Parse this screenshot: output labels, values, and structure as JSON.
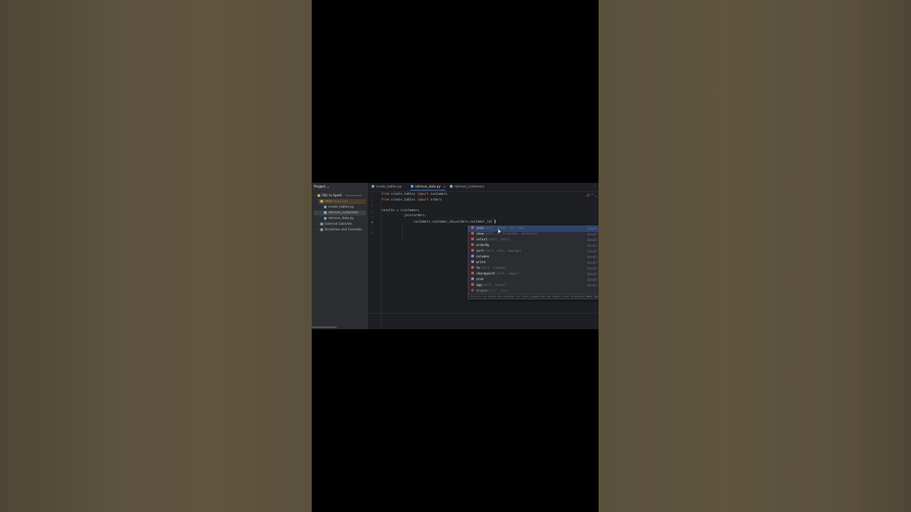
{
  "project": {
    "header": "Project ⌄",
    "root": {
      "name": "SQL to Spark",
      "path": "~/Downloads/t"
    },
    "items": [
      {
        "name": "venv",
        "note": "library root",
        "kind": "folder"
      },
      {
        "name": "create_tables.py",
        "kind": "py"
      },
      {
        "name": "retrieve_customers",
        "kind": "db"
      },
      {
        "name": "retrieve_data.py",
        "kind": "py"
      },
      {
        "name": "External Libraries",
        "kind": "lib"
      },
      {
        "name": "Scratches and Consoles",
        "kind": "lib"
      }
    ]
  },
  "tabs": [
    {
      "label": "create_tables.py",
      "active": false
    },
    {
      "label": "retrieve_data.py",
      "active": true,
      "close": "×"
    },
    {
      "label": "retrieve_customers",
      "active": false
    }
  ],
  "tab_more": "⋮",
  "editor": {
    "warning_count": "⚠2 ^ ⌄",
    "lines": [
      {
        "n": "1",
        "kw1": "from",
        "a": " create_tables ",
        "kw2": "import",
        "b": " customers"
      },
      {
        "n": "2",
        "kw1": "from",
        "a": " create_tables ",
        "kw2": "import",
        "b": " orders"
      },
      {
        "n": "3",
        "text": ""
      },
      {
        "n": "4",
        "text": "results = (customers"
      },
      {
        "n": "5",
        "text": "           .join(orders,"
      },
      {
        "n": "6",
        "text": "                 customers.customer_id==orders.customer_id) "
      },
      {
        "n": "7",
        "text": ""
      },
      {
        "n": "8",
        "text": ""
      }
    ]
  },
  "completion": {
    "items": [
      {
        "kind": "method",
        "name": "join",
        "sig": "(self, other, on, how)",
        "type": "DataFr"
      },
      {
        "kind": "method",
        "name": "show",
        "sig": "(self, n, truncate, vertical)",
        "type": "DataFr"
      },
      {
        "kind": "method",
        "name": "select",
        "sig": "(self, cols)",
        "type": "DataFr"
      },
      {
        "kind": "method",
        "name": "orderBy",
        "sig": "",
        "type": "DataFr"
      },
      {
        "kind": "method",
        "name": "sort",
        "sig": "(self, cols, kwargs)",
        "type": "DataFr"
      },
      {
        "kind": "prop",
        "name": "columns",
        "sig": "",
        "type": "DataFr"
      },
      {
        "kind": "prop",
        "name": "write",
        "sig": "",
        "type": "DataFr"
      },
      {
        "kind": "method",
        "name": "to",
        "sig": "(self, schema)",
        "type": "DataFr"
      },
      {
        "kind": "method",
        "name": "checkpoint",
        "sig": "(self, eager)",
        "type": "DataFr"
      },
      {
        "kind": "prop",
        "name": "stat",
        "sig": "",
        "type": "DataFr"
      },
      {
        "kind": "method",
        "name": "agg",
        "sig": "(self, exprs)",
        "type": "DataFr"
      },
      {
        "kind": "method",
        "name": "dropna",
        "sig": "(self, how)",
        "type": "DataFr"
      }
    ],
    "footer": "Press ⌘. to choose the selected (or first) suggestion and insert a dot afterwards",
    "next_tip": "Next Tip"
  }
}
